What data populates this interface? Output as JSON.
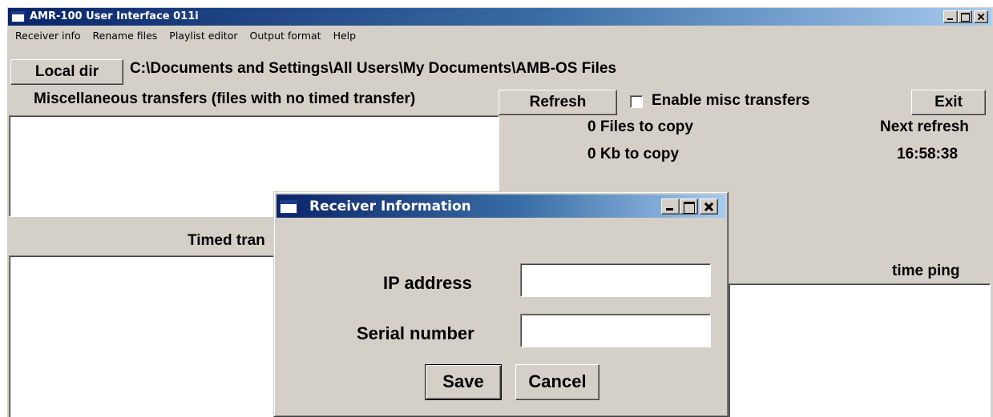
{
  "window": {
    "title": "AMR-100 User Interface 011i"
  },
  "menu": {
    "items": [
      "Receiver info",
      "Rename files",
      "Playlist editor",
      "Output format",
      "Help"
    ]
  },
  "toolbar": {
    "local_dir_label": "Local dir",
    "local_dir_path": "C:\\Documents and Settings\\All Users\\My Documents\\AMB-OS Files"
  },
  "misc": {
    "heading": "Miscellaneous transfers (files with no timed transfer)",
    "refresh_label": "Refresh",
    "enable_label": "Enable misc transfers",
    "enable_checked": false,
    "exit_label": "Exit",
    "files_to_copy": "0 Files to copy",
    "kb_to_copy": "0 Kb to copy",
    "next_refresh_label": "Next refresh",
    "next_refresh_time": "16:58:38"
  },
  "timed": {
    "heading_visible": "Timed tran",
    "time_ping_label": "time ping"
  },
  "dialog": {
    "title": "Receiver Information",
    "ip_label": "IP address",
    "ip_value": "",
    "serial_label": "Serial number",
    "serial_value": "",
    "save_label": "Save",
    "cancel_label": "Cancel"
  },
  "colors": {
    "face": "#d4d0c8",
    "title_start": "#0a246a",
    "title_end": "#a6caf0"
  }
}
